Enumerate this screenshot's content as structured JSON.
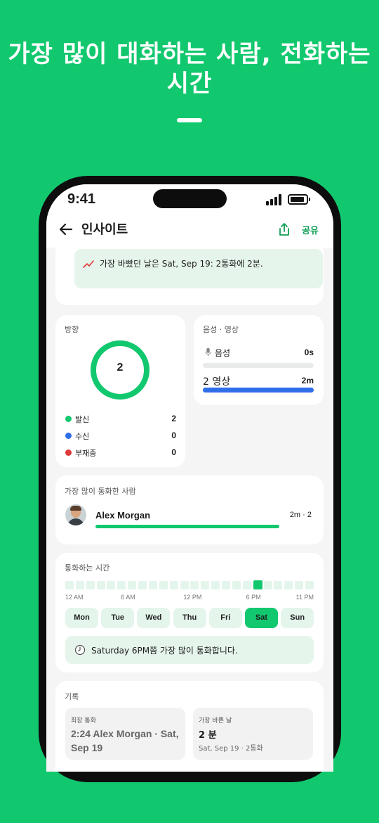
{
  "headline": {
    "line1": "가장 많이 대화하는 사람, 전화하는",
    "line2": "시간"
  },
  "status_bar": {
    "time": "9:41"
  },
  "app_bar": {
    "title": "인사이트",
    "share_label": "공유"
  },
  "insight": {
    "text": "가장 바빴던 날은 Sat, Sep 19: 2통화에 2분."
  },
  "direction": {
    "title": "방향",
    "total": "2",
    "items": [
      {
        "label": "발신",
        "value": "2",
        "color": "#12c86e"
      },
      {
        "label": "수신",
        "value": "0",
        "color": "#2f6ee8"
      },
      {
        "label": "부재중",
        "value": "0",
        "color": "#e03a3a"
      }
    ]
  },
  "media": {
    "title": "음성 · 영상",
    "voice": {
      "label": "음성",
      "value": "0s",
      "fraction": 0,
      "color": "#e9ebea"
    },
    "video": {
      "label": "2 영상",
      "value": "2m",
      "fraction": 1.0,
      "color": "#2f6ee8"
    }
  },
  "top_contact": {
    "title": "가장 많이 통화한 사람",
    "name": "Alex Morgan",
    "stat": "2m · 2",
    "fraction": 1.0,
    "color": "#12c86e"
  },
  "call_time": {
    "title": "통화하는 시간",
    "hours_active": [
      18
    ],
    "hour_count": 24,
    "ticks": [
      "12 AM",
      "6 AM",
      "12 PM",
      "6 PM",
      "11 PM"
    ],
    "days": [
      "Mon",
      "Tue",
      "Wed",
      "Thu",
      "Fri",
      "Sat",
      "Sun"
    ],
    "selected_day": "Sat",
    "summary": "Saturday 6PM쯤 가장 많이 통화합니다."
  },
  "records": {
    "title": "기록",
    "longest": {
      "label": "최장 통화",
      "value": "2:24 Alex Morgan · Sat, Sep 19"
    },
    "busiest": {
      "label": "가장 바쁜 날",
      "value": "2 분",
      "sub": "Sat, Sep 19 · 2통화"
    }
  },
  "colors": {
    "accent": "#12c86e",
    "blue": "#2f6ee8",
    "red": "#e03a3a"
  }
}
